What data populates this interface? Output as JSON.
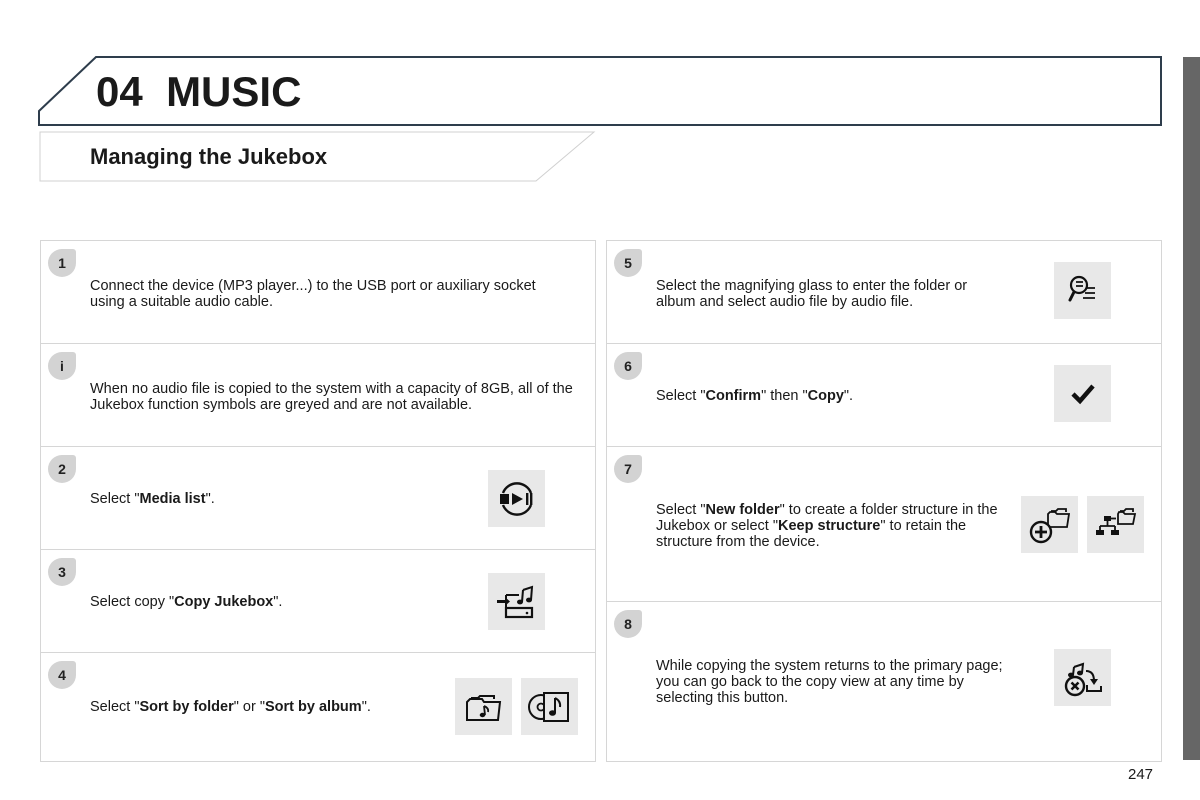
{
  "header": {
    "chapter_number": "04",
    "chapter_title": "MUSIC",
    "section_title": "Managing the Jukebox"
  },
  "colors": {
    "banner_border": "#2e3d4c",
    "badge_bg": "#d3d3d3",
    "icon_bg": "#e8e8e8",
    "side_tab": "#666666"
  },
  "steps_left": [
    {
      "badge": "1",
      "parts": [
        {
          "t": "Connect the device (MP3 player...) to the USB port or auxiliary socket using a suitable audio cable.",
          "b": false
        }
      ]
    },
    {
      "badge": "i",
      "parts": [
        {
          "t": "When no audio file is copied to the system with a capacity of 8GB, all of the Jukebox function symbols are greyed and are not available.",
          "b": false
        }
      ]
    },
    {
      "badge": "2",
      "parts": [
        {
          "t": "Select \"",
          "b": false
        },
        {
          "t": "Media list",
          "b": true
        },
        {
          "t": "\".",
          "b": false
        }
      ],
      "icons": [
        "media-list-icon"
      ]
    },
    {
      "badge": "3",
      "parts": [
        {
          "t": "Select copy \"",
          "b": false
        },
        {
          "t": "Copy Jukebox",
          "b": true
        },
        {
          "t": "\".",
          "b": false
        }
      ],
      "icons": [
        "copy-jukebox-icon"
      ]
    },
    {
      "badge": "4",
      "parts": [
        {
          "t": "Select \"",
          "b": false
        },
        {
          "t": "Sort by folder",
          "b": true
        },
        {
          "t": "\" or \"",
          "b": false
        },
        {
          "t": "Sort by album",
          "b": true
        },
        {
          "t": "\".",
          "b": false
        }
      ],
      "icons": [
        "sort-by-folder-icon",
        "sort-by-album-icon"
      ]
    }
  ],
  "steps_right": [
    {
      "badge": "5",
      "parts": [
        {
          "t": "Select the magnifying glass to enter the folder or album and select audio file by audio file.",
          "b": false
        }
      ],
      "icons": [
        "magnifying-glass-list-icon"
      ]
    },
    {
      "badge": "6",
      "parts": [
        {
          "t": "Select \"",
          "b": false
        },
        {
          "t": "Confirm",
          "b": true
        },
        {
          "t": "\" then \"",
          "b": false
        },
        {
          "t": "Copy",
          "b": true
        },
        {
          "t": "\".",
          "b": false
        }
      ],
      "icons": [
        "confirm-check-icon"
      ]
    },
    {
      "badge": "7",
      "parts": [
        {
          "t": "Select \"",
          "b": false
        },
        {
          "t": "New folder",
          "b": true
        },
        {
          "t": "\" to create a folder structure in the Jukebox or select \"",
          "b": false
        },
        {
          "t": "Keep structure",
          "b": true
        },
        {
          "t": "\" to retain the structure from the device.",
          "b": false
        }
      ],
      "icons": [
        "new-folder-icon",
        "keep-structure-icon"
      ]
    },
    {
      "badge": "8",
      "parts": [
        {
          "t": "While copying the system returns to the primary page; you can go back to the copy view at any time by selecting this button.",
          "b": false
        }
      ],
      "icons": [
        "copy-view-icon"
      ]
    }
  ],
  "footer": {
    "page_number": "247"
  }
}
